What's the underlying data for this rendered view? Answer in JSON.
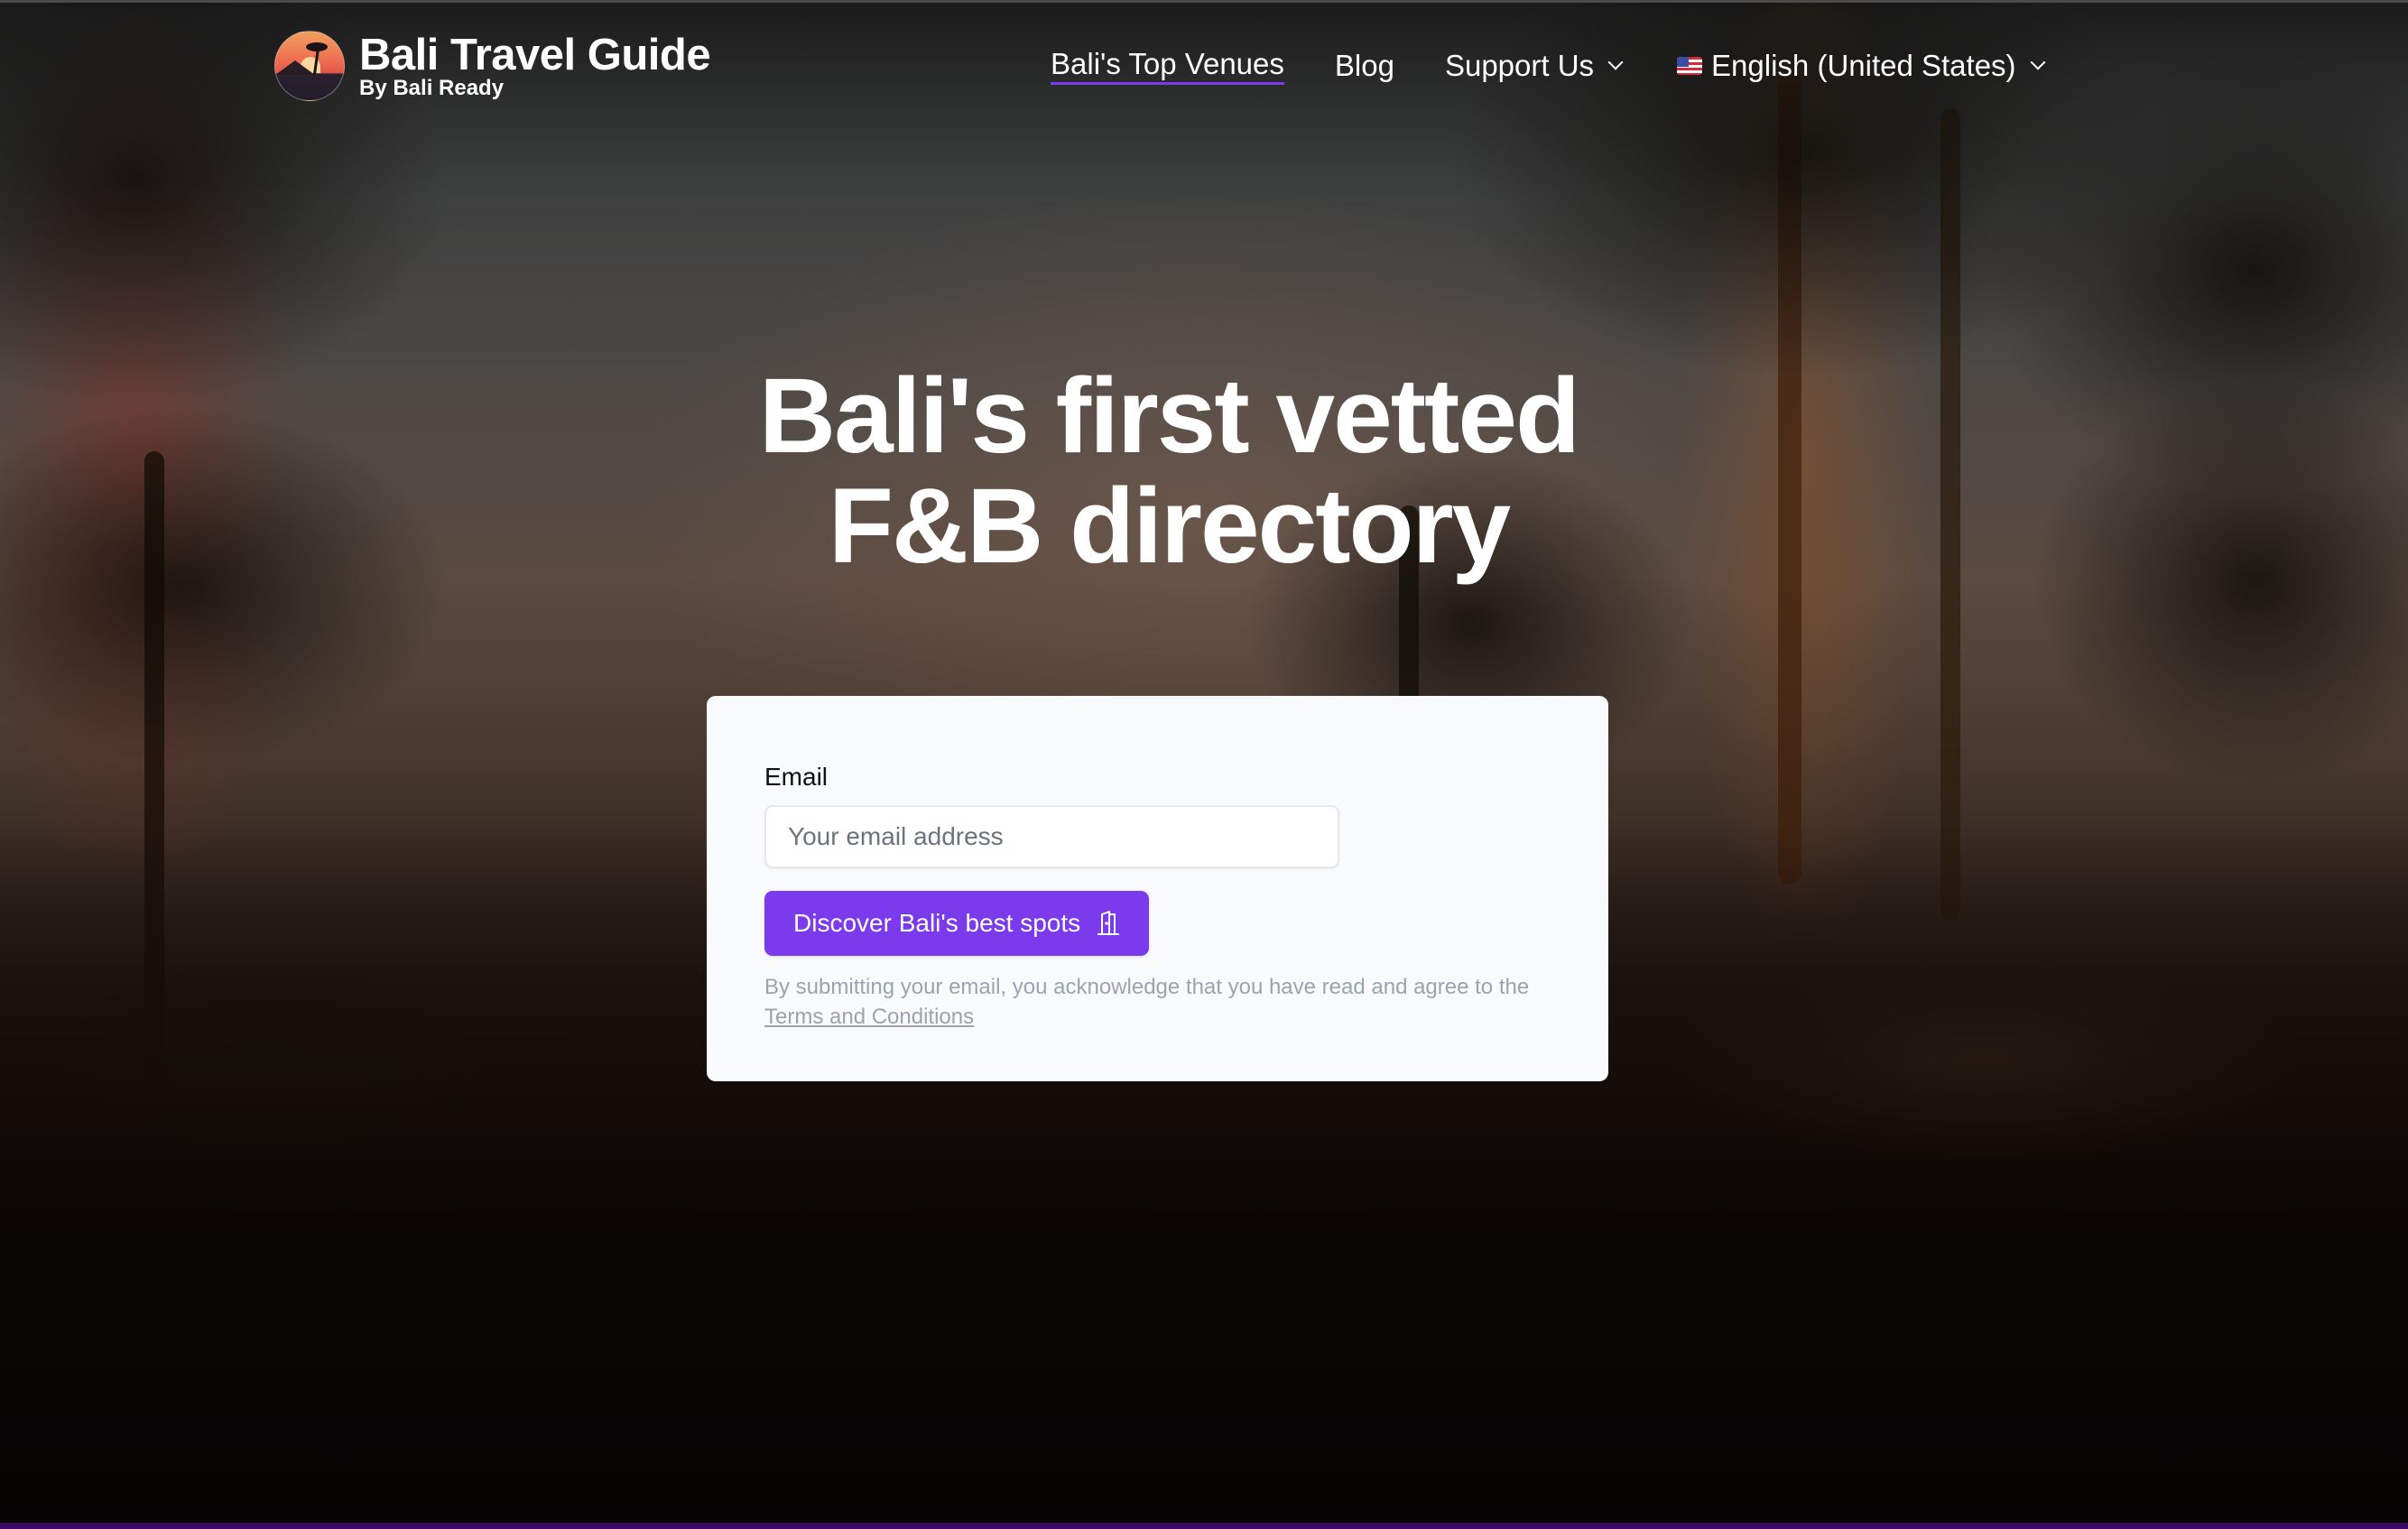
{
  "brand": {
    "title": "Bali Travel Guide",
    "subtitle": "By Bali Ready",
    "logo_icon": "sunset-palm-logo"
  },
  "nav": {
    "items": [
      {
        "label": "Bali's Top Venues",
        "active": true
      },
      {
        "label": "Blog",
        "active": false
      },
      {
        "label": "Support Us",
        "has_dropdown": true
      }
    ],
    "language": {
      "flag_icon": "us-flag-icon",
      "label": "English (United States)",
      "has_dropdown": true
    }
  },
  "hero": {
    "headline_line1": "Bali's first vetted",
    "headline_line2": "F&B directory"
  },
  "signup": {
    "email_label": "Email",
    "email_placeholder": "Your email address",
    "email_value": "",
    "submit_label": "Discover Bali's best spots",
    "submit_icon": "open-door-icon",
    "disclaimer_prefix": "By submitting your email, you acknowledge that you have read and agree to the",
    "terms_link": "Terms and Conditions"
  },
  "colors": {
    "accent": "#7c3aed",
    "footer_strip": "#3b0764",
    "card_bg": "#f8fafc",
    "muted_text": "#9ca3af"
  }
}
